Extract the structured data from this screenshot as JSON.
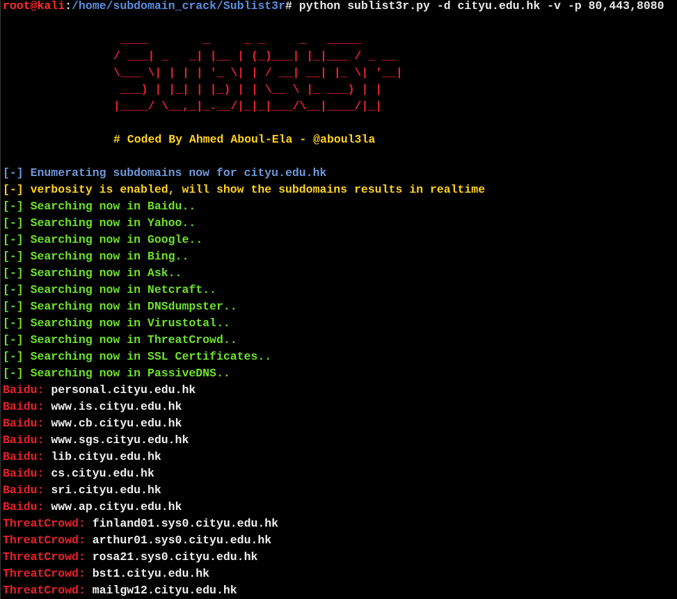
{
  "prompt": {
    "user_host": "root@kali",
    "separator": ":",
    "path": "/home/subdomain_crack/Sublist3r",
    "symbol": "#",
    "command": " python sublist3r.py -d cityu.edu.hk -v -p 80,443,8080"
  },
  "banner": {
    "ascii_lines": [
      " ____        _     _ _     _   _____",
      "/ ___| _   _| |__ | (_)___| |_|___ / _ __",
      "\\___ \\| | | | '_ \\| | / __| __| |_ \\| '__|",
      " ___) | |_| | |_) | | \\__ \\ |_ ___) | |",
      "|____/ \\__,_|_.__/|_|_|___/\\__|____/|_|"
    ],
    "credit": "# Coded By Ahmed Aboul-Ela - @aboul3la"
  },
  "status": {
    "enumerating": "[-] Enumerating subdomains now for cityu.edu.hk",
    "verbosity": "[-] verbosity is enabled, will show the subdomains results in realtime",
    "searching": [
      "[-] Searching now in Baidu..",
      "[-] Searching now in Yahoo..",
      "[-] Searching now in Google..",
      "[-] Searching now in Bing..",
      "[-] Searching now in Ask..",
      "[-] Searching now in Netcraft..",
      "[-] Searching now in DNSdumpster..",
      "[-] Searching now in Virustotal..",
      "[-] Searching now in ThreatCrowd..",
      "[-] Searching now in SSL Certificates..",
      "[-] Searching now in PassiveDNS.."
    ]
  },
  "results": [
    {
      "source": "Baidu:",
      "domain": " personal.cityu.edu.hk"
    },
    {
      "source": "Baidu:",
      "domain": " www.is.cityu.edu.hk"
    },
    {
      "source": "Baidu:",
      "domain": " www.cb.cityu.edu.hk"
    },
    {
      "source": "Baidu:",
      "domain": " www.sgs.cityu.edu.hk"
    },
    {
      "source": "Baidu:",
      "domain": " lib.cityu.edu.hk"
    },
    {
      "source": "Baidu:",
      "domain": " cs.cityu.edu.hk"
    },
    {
      "source": "Baidu:",
      "domain": " sri.cityu.edu.hk"
    },
    {
      "source": "Baidu:",
      "domain": " www.ap.cityu.edu.hk"
    },
    {
      "source": "ThreatCrowd:",
      "domain": " finland01.sys0.cityu.edu.hk"
    },
    {
      "source": "ThreatCrowd:",
      "domain": " arthur01.sys0.cityu.edu.hk"
    },
    {
      "source": "ThreatCrowd:",
      "domain": " rosa21.sys0.cityu.edu.hk"
    },
    {
      "source": "ThreatCrowd:",
      "domain": " bst1.cityu.edu.hk"
    },
    {
      "source": "ThreatCrowd:",
      "domain": " mailgw12.cityu.edu.hk"
    }
  ],
  "colors": {
    "background": "#000000",
    "prompt_user": "#ff2b2b",
    "prompt_path": "#5b8fe0",
    "banner": "#e8222a",
    "credit": "#ffd21e",
    "info_blue": "#6f97d8",
    "info_yellow": "#ffd21e",
    "info_green": "#6ee22a",
    "source_red": "#e8222a",
    "text_white": "#f0f0f0"
  }
}
